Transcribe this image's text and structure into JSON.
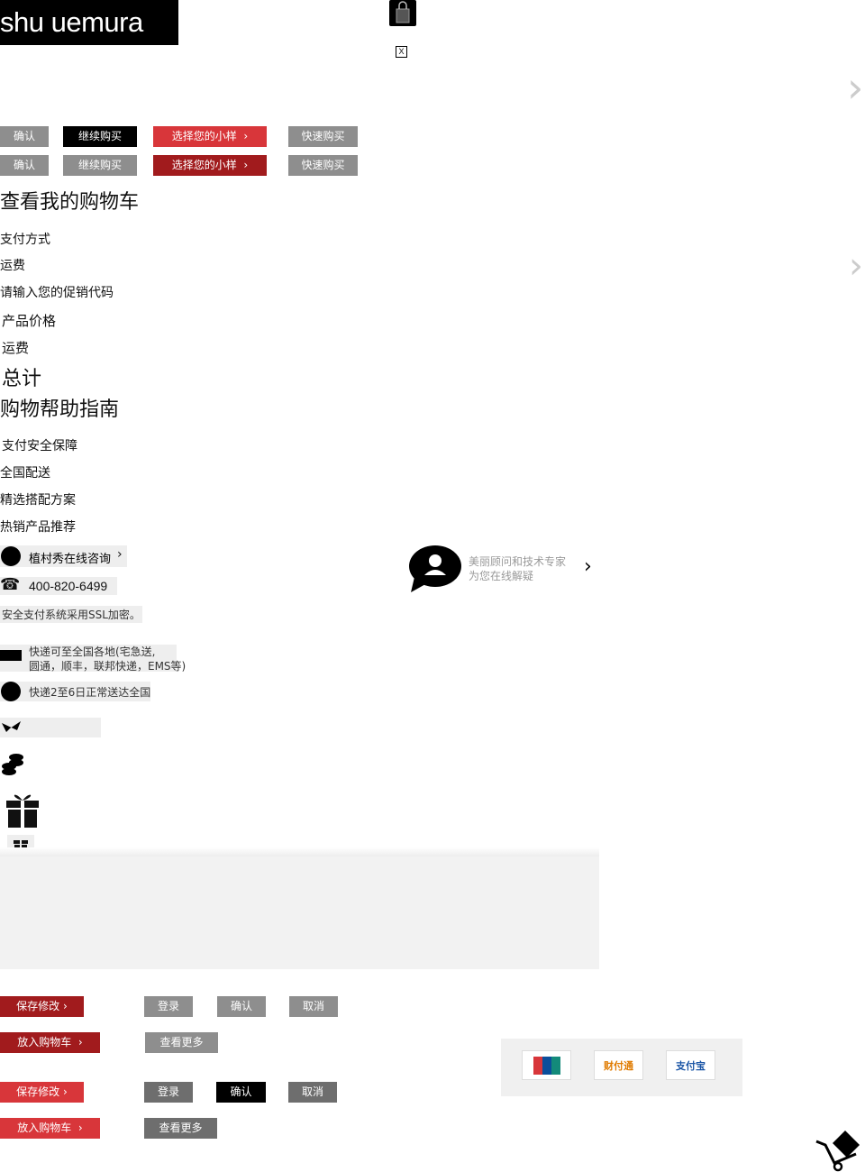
{
  "header": {
    "logo_text": "shu uemura",
    "close_label": "X"
  },
  "buttons_row1": {
    "confirm": "确认",
    "continue_shopping": "继续购买",
    "choose_samples": "选择您的小样",
    "quick_buy": "快速购买"
  },
  "buttons_row2": {
    "confirm": "确认",
    "continue_shopping": "继续购买",
    "choose_samples": "选择您的小样",
    "quick_buy": "快速购买"
  },
  "cart": {
    "title": "查看我的购物车",
    "payment_method": "支付方式",
    "shipping": "运费",
    "promo_code": "请输入您的促销代码",
    "product_price": "产品价格",
    "shipping2": "运费",
    "total": "总计"
  },
  "help": {
    "title": "购物帮助指南",
    "items": [
      "支付安全保障",
      "全国配送",
      "精选搭配方案",
      "热销产品推荐"
    ],
    "consult": "植村秀在线咨询",
    "phone": "400-820-6499",
    "ssl_note": "安全支付系统采用SSL加密。",
    "delivery_note_line1": "快递可至全国各地(宅急送,",
    "delivery_note_line2": "圆通，顺丰，联邦快递，EMS等)",
    "delivery_days": "快递2至6日正常送达全国"
  },
  "advisor": {
    "line1": "美丽顾问和技术专家",
    "line2": "为您在线解疑"
  },
  "actions_a": {
    "save": "保存修改",
    "login": "登录",
    "confirm": "确认",
    "cancel": "取消",
    "add_to_cart": "放入购物车",
    "see_more": "查看更多"
  },
  "actions_b": {
    "save": "保存修改",
    "login": "登录",
    "confirm": "确认",
    "cancel": "取消",
    "add_to_cart": "放入购物车",
    "see_more": "查看更多"
  },
  "payment_logos": {
    "unionpay": "UnionPay 银联",
    "caifutong": "财付通",
    "alipay": "支付宝"
  },
  "colors": {
    "red": "#d8363a",
    "dark_red": "#a11b1d",
    "gray": "#8e8e8e",
    "black": "#000000"
  }
}
